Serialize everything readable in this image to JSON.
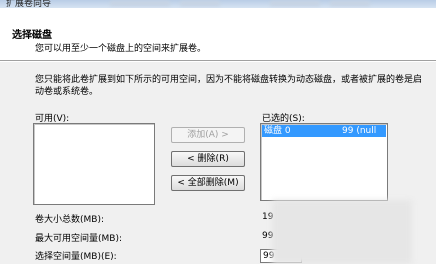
{
  "window": {
    "title": "扩展卷向导"
  },
  "header": {
    "title": "选择磁盘",
    "subtitle": "您可以用至少一个磁盘上的空间来扩展卷。"
  },
  "description": "您只能将此卷扩展到如下所示的可用空间，因为不能将磁盘转换为动态磁盘，或者被扩展的卷是启动卷或系统卷。",
  "available": {
    "label": "可用(V):",
    "items": []
  },
  "selected": {
    "label": "已选的(S):",
    "items": [
      {
        "name": "磁盘 0",
        "size": "99",
        "note": "(null"
      }
    ]
  },
  "buttons": {
    "add": "添加(A) >",
    "remove": "< 删除(R)",
    "remove_all": "< 全部删除(M)"
  },
  "fields": {
    "total_label": "卷大小总数(MB):",
    "total_value": "19",
    "max_label": "最大可用空间量(MB):",
    "max_value": "99",
    "select_label": "选择空间量(MB)(E):",
    "select_value": "99"
  }
}
